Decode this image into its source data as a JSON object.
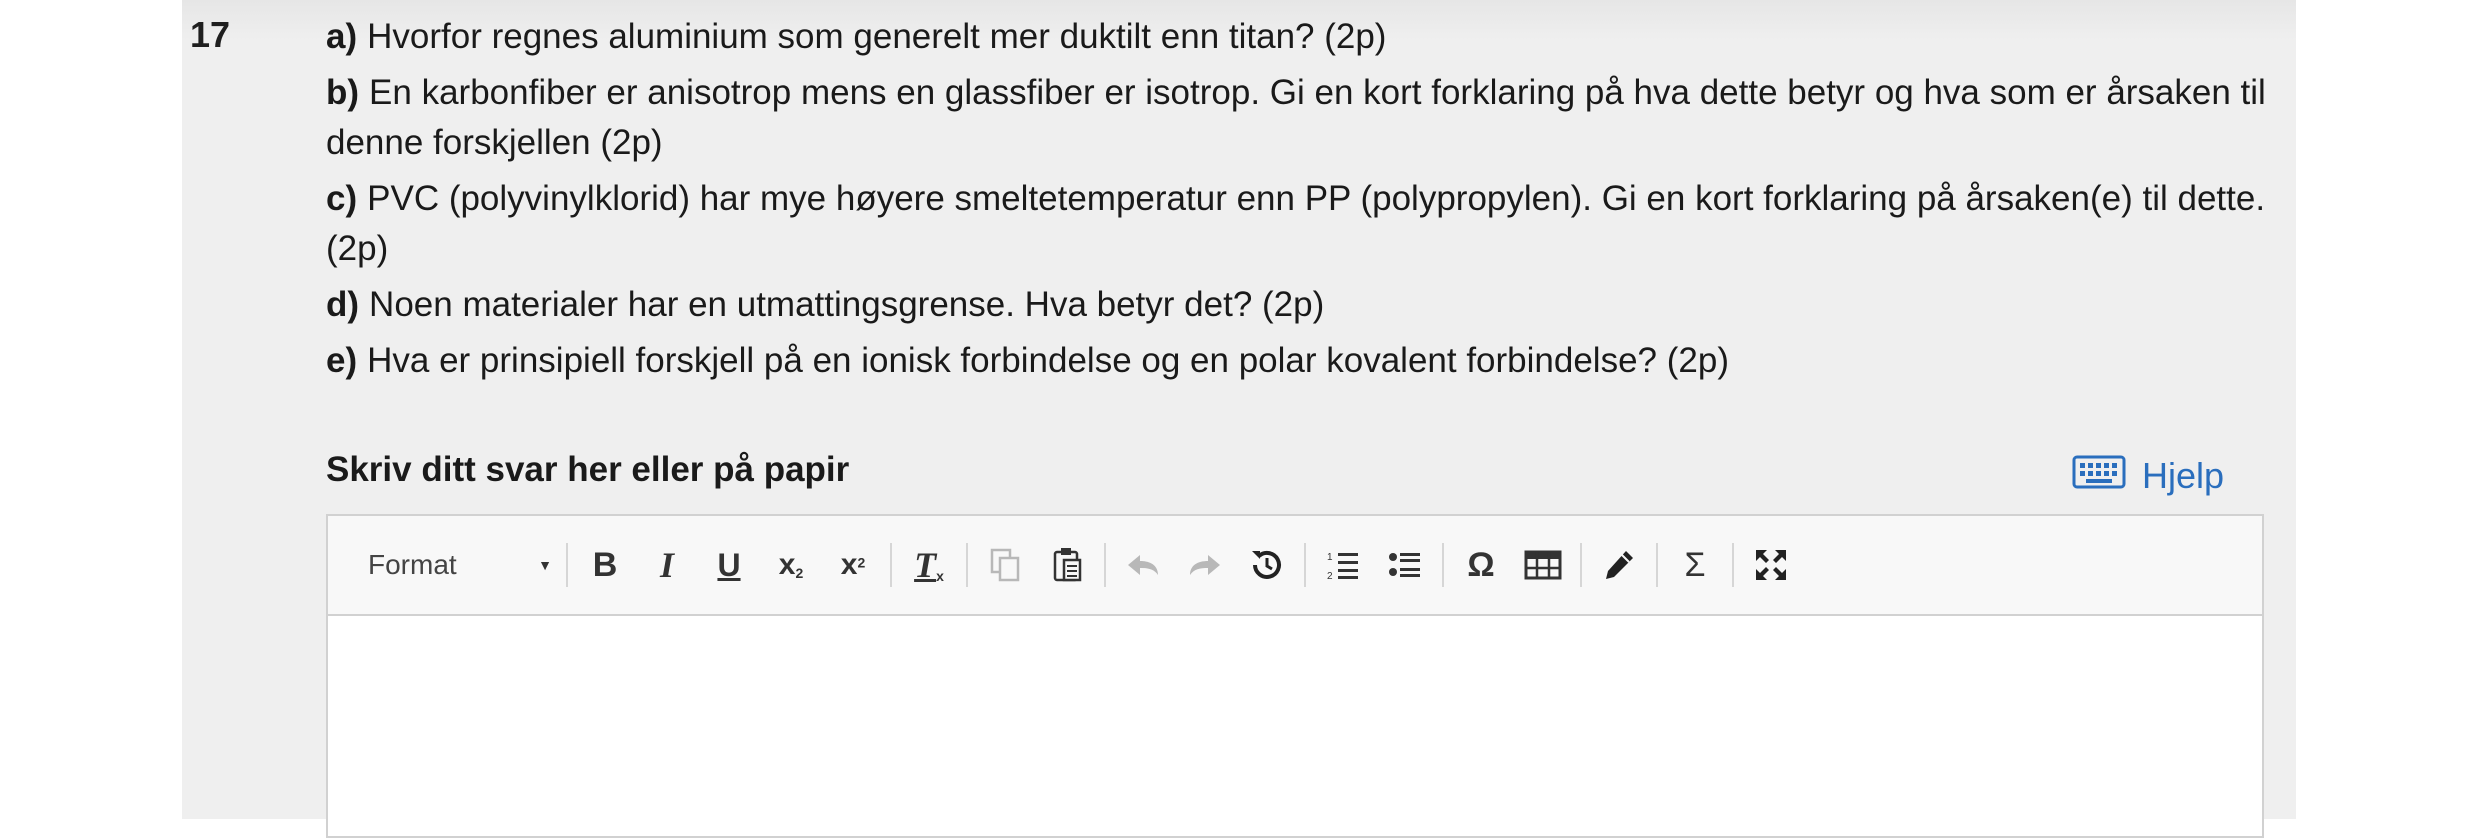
{
  "question": {
    "number": "17",
    "parts": [
      {
        "letter": "a)",
        "text": "Hvorfor regnes aluminium som generelt mer duktilt enn titan? (2p)"
      },
      {
        "letter": "b)",
        "text": "En karbonfiber er anisotrop mens en glassfiber er isotrop. Gi en kort forklaring på hva dette betyr og hva som er årsaken til denne forskjellen (2p)"
      },
      {
        "letter": "c)",
        "text": "PVC (polyvinylklorid) har mye høyere smeltetemperatur enn PP (polypropylen). Gi en kort forklaring på årsaken(e) til dette. (2p)"
      },
      {
        "letter": "d)",
        "text": "Noen materialer har en utmattingsgrense. Hva betyr det? (2p)"
      },
      {
        "letter": "e)",
        "text": "Hva er prinsipiell forskjell på en ionisk forbindelse og en polar kovalent forbindelse? (2p)"
      }
    ]
  },
  "answer": {
    "title": "Skriv ditt svar her eller på papir",
    "help_label": "Hjelp"
  },
  "toolbar": {
    "format_label": "Format",
    "bold": "B",
    "italic": "I",
    "underline": "U",
    "subscript": "x",
    "superscript": "x",
    "clear_format": "T",
    "clear_format_sub": "x",
    "special_char": "Ω",
    "formula": "Σ"
  },
  "colors": {
    "link": "#2a6ebd",
    "panel_bg": "#efefef",
    "disabled_icon": "#b8b8b8"
  }
}
